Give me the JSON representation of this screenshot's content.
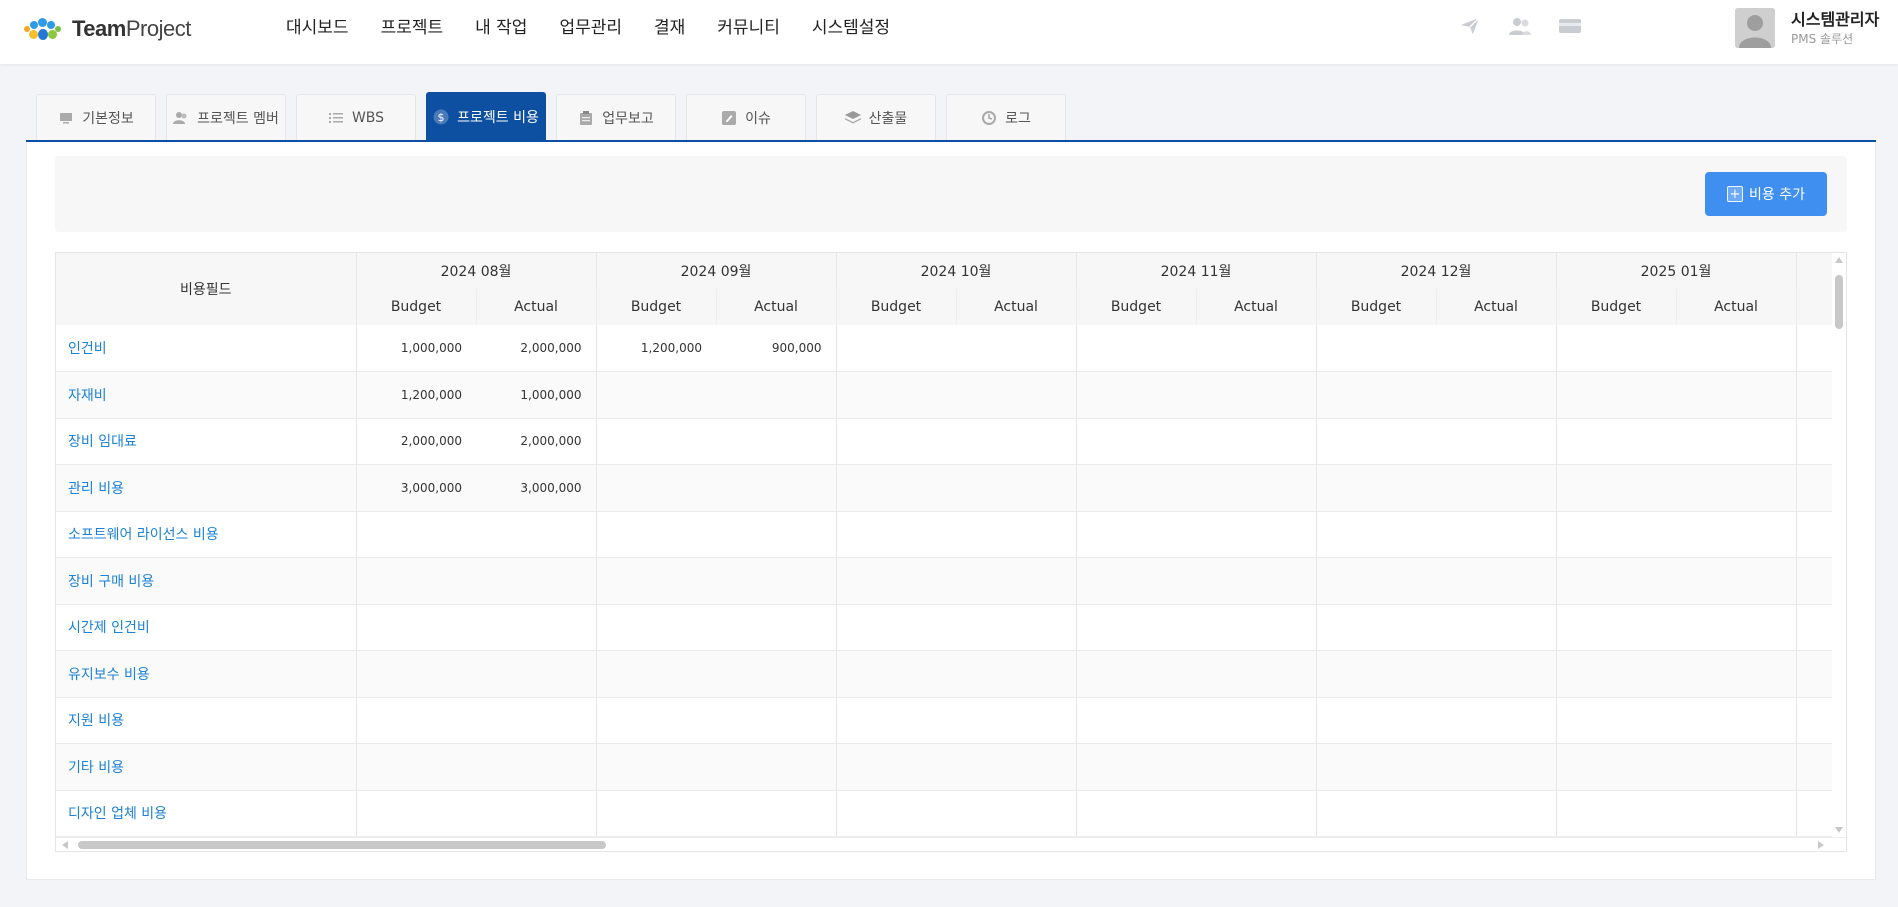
{
  "header": {
    "logo": {
      "team": "Team",
      "project": "Project"
    },
    "nav": [
      "대시보드",
      "프로젝트",
      "내 작업",
      "업무관리",
      "결재",
      "커뮤니티",
      "시스템설정"
    ],
    "icons": [
      "paper-plane-icon",
      "users-icon",
      "card-icon"
    ],
    "user": {
      "name": "시스템관리자",
      "role": "PMS 솔루션"
    }
  },
  "tabs": [
    {
      "label": "기본정보",
      "icon": "monitor-icon",
      "active": false
    },
    {
      "label": "프로젝트 멤버",
      "icon": "members-icon",
      "active": false
    },
    {
      "label": "WBS",
      "icon": "list-icon",
      "active": false
    },
    {
      "label": "프로젝트 비용",
      "icon": "dollar-icon",
      "active": true
    },
    {
      "label": "업무보고",
      "icon": "clipboard-icon",
      "active": false
    },
    {
      "label": "이슈",
      "icon": "pen-icon",
      "active": false
    },
    {
      "label": "산출물",
      "icon": "layers-icon",
      "active": false
    },
    {
      "label": "로그",
      "icon": "history-icon",
      "active": false
    }
  ],
  "toolbar": {
    "add_label": "비용 추가"
  },
  "table": {
    "field_header": "비용필드",
    "budget_label": "Budget",
    "actual_label": "Actual",
    "months": [
      "2024 08월",
      "2024 09월",
      "2024 10월",
      "2024 11월",
      "2024 12월",
      "2025 01월"
    ],
    "rows": [
      {
        "name": "인건비",
        "values": [
          [
            "1,000,000",
            "2,000,000"
          ],
          [
            "1,200,000",
            "900,000"
          ],
          [
            "",
            ""
          ],
          [
            "",
            ""
          ],
          [
            "",
            ""
          ],
          [
            "",
            ""
          ]
        ]
      },
      {
        "name": "자재비",
        "values": [
          [
            "1,200,000",
            "1,000,000"
          ],
          [
            "",
            ""
          ],
          [
            "",
            ""
          ],
          [
            "",
            ""
          ],
          [
            "",
            ""
          ],
          [
            "",
            ""
          ]
        ]
      },
      {
        "name": "장비 임대료",
        "values": [
          [
            "2,000,000",
            "2,000,000"
          ],
          [
            "",
            ""
          ],
          [
            "",
            ""
          ],
          [
            "",
            ""
          ],
          [
            "",
            ""
          ],
          [
            "",
            ""
          ]
        ]
      },
      {
        "name": "관리 비용",
        "values": [
          [
            "3,000,000",
            "3,000,000"
          ],
          [
            "",
            ""
          ],
          [
            "",
            ""
          ],
          [
            "",
            ""
          ],
          [
            "",
            ""
          ],
          [
            "",
            ""
          ]
        ]
      },
      {
        "name": "소프트웨어 라이선스 비용",
        "values": [
          [
            "",
            ""
          ],
          [
            "",
            ""
          ],
          [
            "",
            ""
          ],
          [
            "",
            ""
          ],
          [
            "",
            ""
          ],
          [
            "",
            ""
          ]
        ]
      },
      {
        "name": "장비 구매 비용",
        "values": [
          [
            "",
            ""
          ],
          [
            "",
            ""
          ],
          [
            "",
            ""
          ],
          [
            "",
            ""
          ],
          [
            "",
            ""
          ],
          [
            "",
            ""
          ]
        ]
      },
      {
        "name": "시간제 인건비",
        "values": [
          [
            "",
            ""
          ],
          [
            "",
            ""
          ],
          [
            "",
            ""
          ],
          [
            "",
            ""
          ],
          [
            "",
            ""
          ],
          [
            "",
            ""
          ]
        ]
      },
      {
        "name": "유지보수 비용",
        "values": [
          [
            "",
            ""
          ],
          [
            "",
            ""
          ],
          [
            "",
            ""
          ],
          [
            "",
            ""
          ],
          [
            "",
            ""
          ],
          [
            "",
            ""
          ]
        ]
      },
      {
        "name": "지원 비용",
        "values": [
          [
            "",
            ""
          ],
          [
            "",
            ""
          ],
          [
            "",
            ""
          ],
          [
            "",
            ""
          ],
          [
            "",
            ""
          ],
          [
            "",
            ""
          ]
        ]
      },
      {
        "name": "기타 비용",
        "values": [
          [
            "",
            ""
          ],
          [
            "",
            ""
          ],
          [
            "",
            ""
          ],
          [
            "",
            ""
          ],
          [
            "",
            ""
          ],
          [
            "",
            ""
          ]
        ]
      },
      {
        "name": "디자인 업체 비용",
        "values": [
          [
            "",
            ""
          ],
          [
            "",
            ""
          ],
          [
            "",
            ""
          ],
          [
            "",
            ""
          ],
          [
            "",
            ""
          ],
          [
            "",
            ""
          ]
        ]
      }
    ]
  },
  "colors": {
    "primary": "#0d4fa0",
    "button": "#3f8ff0",
    "link": "#1b82d8"
  }
}
